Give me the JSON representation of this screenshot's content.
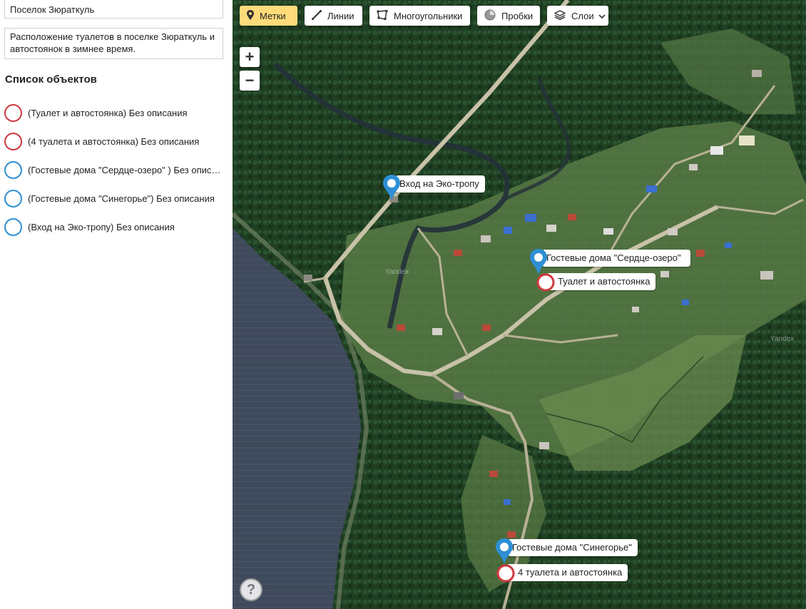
{
  "panel": {
    "name_value": "Поселок Зюраткуль",
    "description_value": "Расположение туалетов в поселке Зюраткуль и автостоянок в зимнее время.",
    "list_title": "Список объектов",
    "items": [
      {
        "text": "(Туалет и автостоянка) Без описания",
        "color": "#d0393e"
      },
      {
        "text": "(4 туалета и автостоянка) Без описания",
        "color": "#d0393e"
      },
      {
        "text": "(Гостевые дома \"Сердце-озеро\" ) Без описания",
        "color": "#2e8fd5"
      },
      {
        "text": "(Гостевые дома \"Синегорье\") Без описания",
        "color": "#2e8fd5"
      },
      {
        "text": "(Вход на Эко-тропу) Без описания",
        "color": "#2e8fd5"
      }
    ]
  },
  "toolbar": {
    "marks": "Метки",
    "lines": "Линии",
    "polygons": "Многоугольники",
    "traffic": "Пробки",
    "layers": "Слои"
  },
  "icons": {
    "marks": "map-pin-icon",
    "lines": "line-icon",
    "polygons": "polygon-icon",
    "traffic": "traffic-icon",
    "layers": "layers-icon",
    "layers_arrow": "chevron-down-icon",
    "zoom_in": "plus-icon",
    "zoom_out": "minus-icon",
    "help": "question-icon"
  },
  "zoom": {
    "in": "+",
    "out": "−"
  },
  "help": "?",
  "watermark": "Yandex",
  "map_pins": [
    {
      "label": "Вход на Эко-тропу",
      "kind": "blue-drop"
    },
    {
      "label": "Гостевые дома \"Сердце-озеро\"",
      "kind": "blue-drop"
    },
    {
      "label": "Туалет и автостоянка",
      "kind": "red-circle"
    },
    {
      "label": "Гостевые дома \"Синегорье\"",
      "kind": "blue-drop"
    },
    {
      "label": "4 туалета и автостоянка",
      "kind": "red-circle"
    }
  ],
  "colors": {
    "accent": "#ffdb7a",
    "blue_marker": "#2e8fd5",
    "red_marker": "#d0393e"
  }
}
